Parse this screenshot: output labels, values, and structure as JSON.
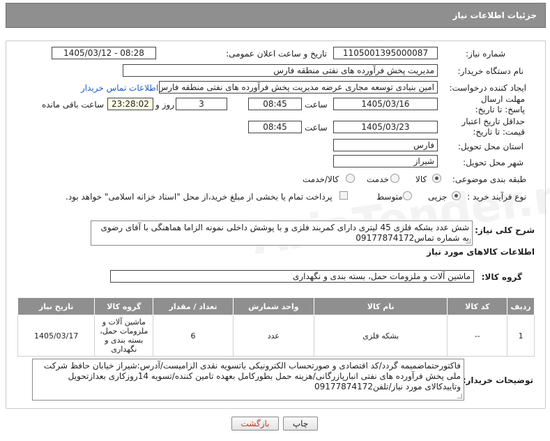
{
  "title": "جزئیات اطلاعات نیاز",
  "watermark": "AriaTender.net",
  "fields": {
    "need_number_label": "شماره نیاز:",
    "need_number": "1105001395000087",
    "announce_label": "تاریخ و ساعت اعلان عمومی:",
    "announce_value": "1405/03/12 - 08:28",
    "buyer_label": "نام دستگاه خریدار:",
    "buyer": "مدیریت پخش فرآورده های نفتی منطقه فارس",
    "creator_label": "ایجاد کننده درخواست:",
    "creator": "امین بنیادی توسعه مجاری عرضه مدیریت پخش فرآورده های نفتی منطقه فارس",
    "contact_link": "اطلاعات تماس خریدار",
    "deadline_label": "مهلت ارسال پاسخ: تا تاریخ:",
    "deadline_date": "1405/03/16",
    "time_label": "ساعت",
    "deadline_time": "08:45",
    "days_value": "3",
    "days_label": "روز و",
    "remaining_value": "23:28:02",
    "remaining_label": "ساعت باقی مانده",
    "validity_label": "حداقل تاریخ اعتبار قیمت: تا تاریخ:",
    "validity_date": "1405/03/23",
    "validity_time": "08:45",
    "province_label": "استان محل تحویل:",
    "province": "فارس",
    "city_label": "شهر محل تحویل:",
    "city": "شیراز",
    "category_label": "طبقه بندی موضوعی:",
    "category_options": [
      "کالا",
      "خدمت",
      "کالا/خدمت"
    ],
    "purchase_label": "نوع فرآیند خرید :",
    "purchase_options": [
      "جزیی",
      "متوسط"
    ],
    "payment_note": "پرداخت تمام یا بخشی از مبلغ خرید،از محل \"اسناد خزانه اسلامی\" خواهد بود."
  },
  "summary": {
    "label": "شرح کلی نیاز:",
    "text": "شش عدد بشکه فلزی 45 لیتری دارای کمربند فلزی و با پوشش داخلی نمونه الزاما هماهنگی با آقای رضوی به شماره تماس09177874172"
  },
  "goods_info_title": "اطلاعات کالاهای مورد نیاز",
  "goods_group": {
    "label": "گروه کالا:",
    "value": "ماشین آلات و ملزومات حمل، بسته بندی و نگهداری"
  },
  "table": {
    "headers": [
      "ردیف",
      "کد کالا",
      "نام کالا",
      "واحد شمارش",
      "تعداد / مقدار",
      "گروه کالا",
      "تاریخ نیاز"
    ],
    "rows": [
      [
        "1",
        "--",
        "بشکه فلزی",
        "عدد",
        "6",
        "ماشین آلات و ملزومات حمل، بسته بندی و نگهداری",
        "1405/03/17"
      ]
    ]
  },
  "buyer_notes": {
    "label": "توضیحات خریدار:",
    "text": "فاکتورحتماضمیمه گردد/کد اقتصادی و صورتحساب الکترونیکی باتسویه نقدی الزامیست/آدرس:شیراز خیابان حافظ شرکت ملی پخش فرآورده های نفتی انبارپازرگانی/هزینه حمل بطورکامل بعهده تامین کننده/تسویه 14روزکاری بعدازتحویل وتاییدکالای مورد نیاز/تلفن09177874172"
  },
  "buttons": {
    "print": "چاپ",
    "back": "بازگشت"
  }
}
